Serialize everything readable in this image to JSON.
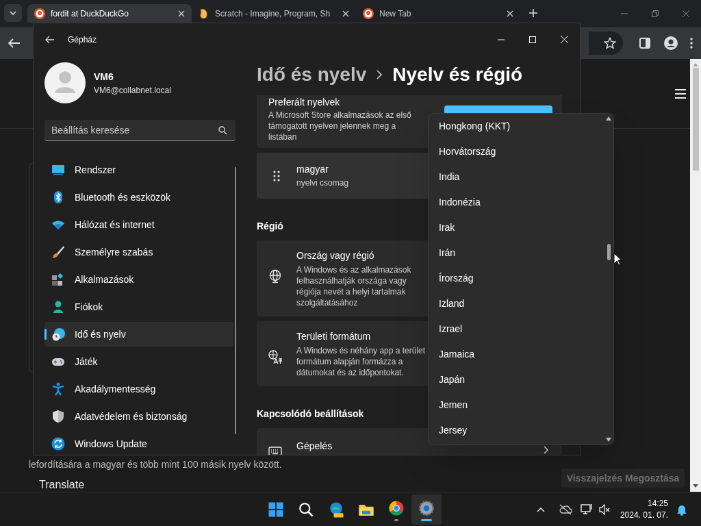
{
  "browser": {
    "tabs": [
      {
        "title": "fordit at DuckDuckGo",
        "selected": true
      },
      {
        "title": "Scratch - Imagine, Program, Sh",
        "selected": false
      },
      {
        "title": "New Tab",
        "selected": false
      }
    ],
    "page": {
      "text": "lefordítására a magyar és több mint 100 másik nyelv között.",
      "heading": "Translate",
      "feedback_button": "Visszajelzés Megosztása"
    }
  },
  "settings": {
    "window_title": "Gépház",
    "user": {
      "name": "VM6",
      "email": "VM6@collabnet.local"
    },
    "search": {
      "placeholder": "Beállítás keresése"
    },
    "nav": [
      {
        "label": "Rendszer",
        "selected": false
      },
      {
        "label": "Bluetooth és eszközök",
        "selected": false
      },
      {
        "label": "Hálózat és internet",
        "selected": false
      },
      {
        "label": "Személyre szabás",
        "selected": false
      },
      {
        "label": "Alkalmazások",
        "selected": false
      },
      {
        "label": "Fiókok",
        "selected": false
      },
      {
        "label": "Idő és nyelv",
        "selected": true
      },
      {
        "label": "Játék",
        "selected": false
      },
      {
        "label": "Akadálymentesség",
        "selected": false
      },
      {
        "label": "Adatvédelem és biztonság",
        "selected": false
      },
      {
        "label": "Windows Update",
        "selected": false
      }
    ],
    "breadcrumb": {
      "parent": "Idő és nyelv",
      "current": "Nyelv és régió"
    },
    "preferred": {
      "title": "Preferált nyelvek",
      "description": "A Microsoft Store alkalmazások az első támogatott nyelven jelennek meg a listában"
    },
    "language": {
      "name": "magyar",
      "detail": "nyelvi csomag"
    },
    "sections": [
      {
        "heading": "Régió",
        "cards": [
          {
            "kind": "dropdown",
            "title": "Ország vagy régió",
            "description": "A Windows és az alkalmazások felhasználhatják országa vagy régiója nevét a helyi tartalmak szolgáltatásához"
          },
          {
            "kind": "dropdown",
            "title": "Területi formátum",
            "description": "A Windows és néhány app a terület formátum alapján formázza a dátumokat és az időpontokat."
          }
        ]
      },
      {
        "heading": "Kapcsolódó beállítások",
        "cards": [
          {
            "kind": "link",
            "title": "Gépelés"
          }
        ]
      }
    ]
  },
  "country_dropdown": {
    "options": [
      "Hongkong (KKT)",
      "Horvátország",
      "India",
      "Indonézia",
      "Irak",
      "Irán",
      "Írország",
      "Izland",
      "Izrael",
      "Jamaica",
      "Japán",
      "Jemen",
      "Jersey"
    ]
  },
  "taskbar": {
    "time": "14:25",
    "date": "2024. 01. 07."
  }
}
